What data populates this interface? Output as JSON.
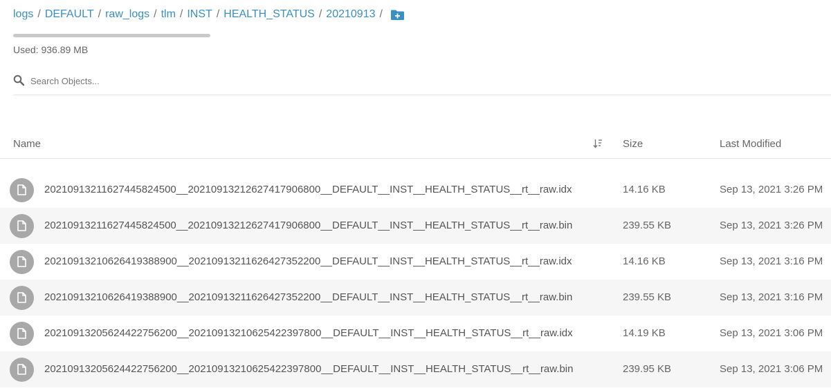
{
  "breadcrumb": {
    "items": [
      "logs",
      "DEFAULT",
      "raw_logs",
      "tlm",
      "INST",
      "HEALTH_STATUS",
      "20210913"
    ],
    "separator": "/",
    "add_folder_icon": "folder-plus-icon"
  },
  "usage": {
    "label": "Used: 936.89 MB"
  },
  "search": {
    "placeholder": "Search Objects..."
  },
  "table": {
    "columns": {
      "name": "Name",
      "size": "Size",
      "modified": "Last Modified"
    },
    "rows": [
      {
        "name": "20210913211627445824500__20210913212627417906800__DEFAULT__INST__HEALTH_STATUS__rt__raw.idx",
        "size": "14.16 KB",
        "modified": "Sep 13, 2021 3:26 PM"
      },
      {
        "name": "20210913211627445824500__20210913212627417906800__DEFAULT__INST__HEALTH_STATUS__rt__raw.bin",
        "size": "239.55 KB",
        "modified": "Sep 13, 2021 3:26 PM"
      },
      {
        "name": "20210913210626419388900__20210913211626427352200__DEFAULT__INST__HEALTH_STATUS__rt__raw.idx",
        "size": "14.16 KB",
        "modified": "Sep 13, 2021 3:16 PM"
      },
      {
        "name": "20210913210626419388900__20210913211626427352200__DEFAULT__INST__HEALTH_STATUS__rt__raw.bin",
        "size": "239.55 KB",
        "modified": "Sep 13, 2021 3:16 PM"
      },
      {
        "name": "20210913205624422756200__20210913210625422397800__DEFAULT__INST__HEALTH_STATUS__rt__raw.idx",
        "size": "14.19 KB",
        "modified": "Sep 13, 2021 3:06 PM"
      },
      {
        "name": "20210913205624422756200__20210913210625422397800__DEFAULT__INST__HEALTH_STATUS__rt__raw.bin",
        "size": "239.95 KB",
        "modified": "Sep 13, 2021 3:06 PM"
      }
    ]
  },
  "colors": {
    "link": "#3a8fc4",
    "alt_row": "#f6f6f6",
    "file_icon_bg": "#a8a8a8"
  }
}
